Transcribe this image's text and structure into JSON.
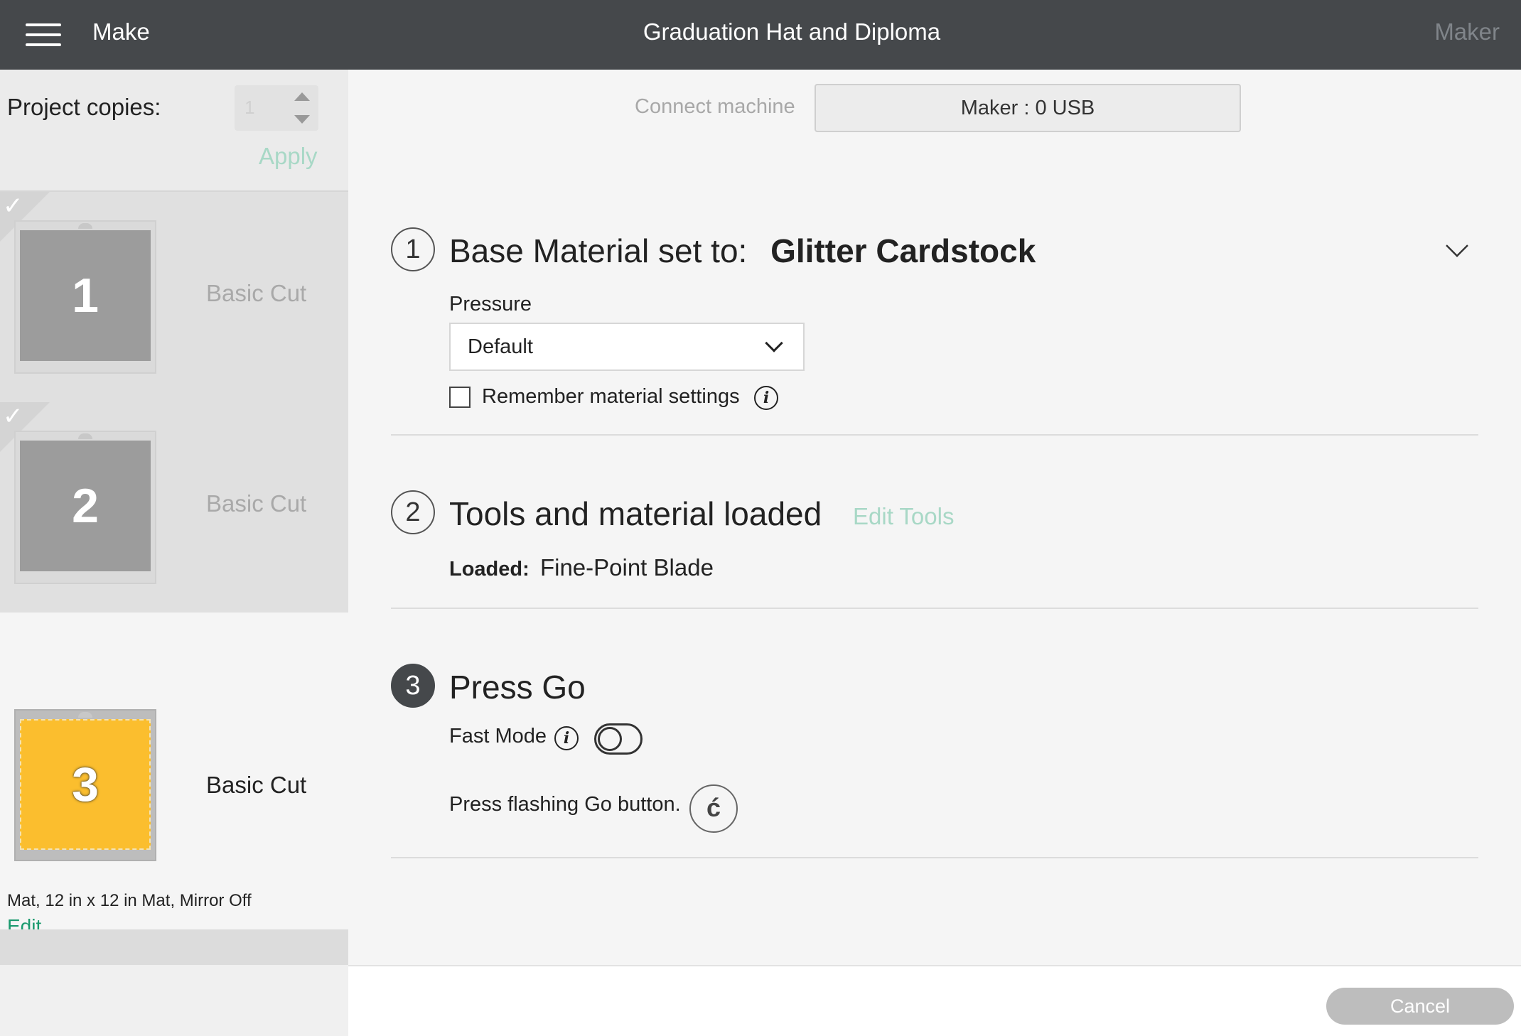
{
  "header": {
    "menu_icon": "hamburger-icon",
    "section": "Make",
    "title": "Graduation Hat and Diploma",
    "machine": "Maker"
  },
  "sidebar": {
    "copies_label": "Project copies:",
    "copies_value": "1",
    "apply_label": "Apply",
    "mats": [
      {
        "number": "1",
        "label": "Basic Cut",
        "done": true
      },
      {
        "number": "2",
        "label": "Basic Cut",
        "done": true
      },
      {
        "number": "3",
        "label": "Basic Cut",
        "done": false,
        "color": "#fbbe2e"
      }
    ],
    "mat_info": "Mat, 12 in x 12 in Mat, Mirror Off",
    "edit_label": "Edit",
    "arrow_color": "#e0151b"
  },
  "main": {
    "connect_label": "Connect machine",
    "machine_button": "Maker : 0 USB",
    "steps": [
      {
        "number": "1",
        "title": "Base Material set to:",
        "material": "Glitter Cardstock"
      },
      {
        "number": "2",
        "title": "Tools and material loaded"
      },
      {
        "number": "3",
        "title": "Press Go"
      }
    ],
    "pressure_label": "Pressure",
    "pressure_value": "Default",
    "remember_label": "Remember material settings",
    "edit_tools_label": "Edit Tools",
    "loaded_label": "Loaded:",
    "loaded_value": "Fine-Point Blade",
    "fast_mode_label": "Fast Mode",
    "fast_mode_on": false,
    "press_go_text": "Press flashing Go button.",
    "go_icon_glyph": "ć"
  },
  "footer": {
    "cancel_label": "Cancel"
  },
  "colors": {
    "header_bg": "#45484b",
    "accent_green": "#1a9a6e",
    "muted_green": "#a8d8c6"
  }
}
